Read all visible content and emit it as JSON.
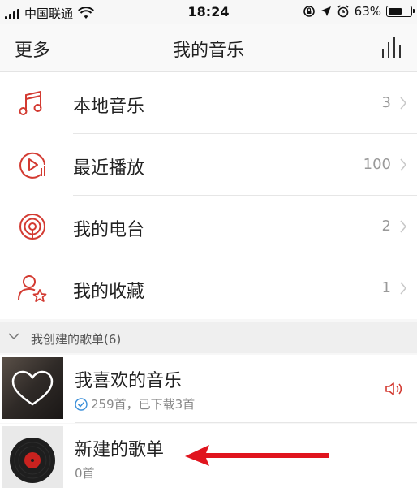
{
  "status_bar": {
    "carrier": "中国联通",
    "time": "18:24",
    "battery_percent": "63%",
    "battery_level": 0.63
  },
  "nav": {
    "left_label": "更多",
    "title": "我的音乐"
  },
  "menu": [
    {
      "label": "本地音乐",
      "count": "3",
      "icon": "music-note-icon"
    },
    {
      "label": "最近播放",
      "count": "100",
      "icon": "recent-play-icon"
    },
    {
      "label": "我的电台",
      "count": "2",
      "icon": "radio-icon"
    },
    {
      "label": "我的收藏",
      "count": "1",
      "icon": "favorite-user-star-icon"
    }
  ],
  "section": {
    "title": "我创建的歌单(6)"
  },
  "playlists": [
    {
      "name": "我喜欢的音乐",
      "sub": "259首，已下载3首",
      "icon": "heart-icon"
    },
    {
      "name": "新建的歌单",
      "sub": "0首",
      "icon": "vinyl-record-icon"
    }
  ],
  "colors": {
    "accent": "#d33a31",
    "annotation_arrow": "#e0141e"
  }
}
